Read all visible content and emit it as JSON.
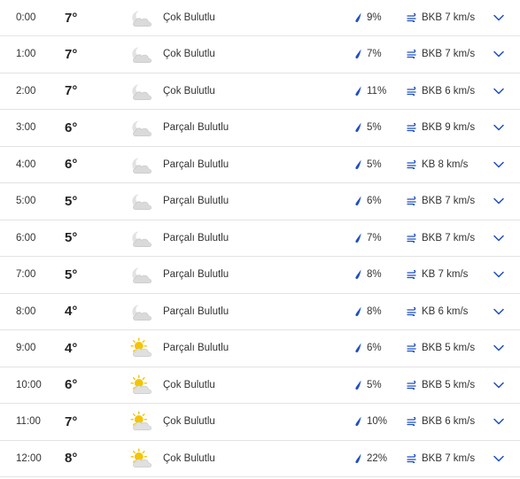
{
  "colors": {
    "accent_blue": "#1e4fc2",
    "divider": "#e3e3e3",
    "cloud": "#d6d6d6",
    "sun": "#f5c400"
  },
  "rows": [
    {
      "time": "0:00",
      "temp": "7°",
      "icon": "night-cloudy-icon",
      "condition": "Çok Bulutlu",
      "precip": "9%",
      "wind": "BKB 7 km/s"
    },
    {
      "time": "1:00",
      "temp": "7°",
      "icon": "night-cloudy-icon",
      "condition": "Çok Bulutlu",
      "precip": "7%",
      "wind": "BKB 7 km/s"
    },
    {
      "time": "2:00",
      "temp": "7°",
      "icon": "night-cloudy-icon",
      "condition": "Çok Bulutlu",
      "precip": "11%",
      "wind": "BKB 6 km/s"
    },
    {
      "time": "3:00",
      "temp": "6°",
      "icon": "night-partly-cloudy-icon",
      "condition": "Parçalı Bulutlu",
      "precip": "5%",
      "wind": "BKB 9 km/s"
    },
    {
      "time": "4:00",
      "temp": "6°",
      "icon": "night-partly-cloudy-icon",
      "condition": "Parçalı Bulutlu",
      "precip": "5%",
      "wind": "KB 8 km/s"
    },
    {
      "time": "5:00",
      "temp": "5°",
      "icon": "night-partly-cloudy-icon",
      "condition": "Parçalı Bulutlu",
      "precip": "6%",
      "wind": "BKB 7 km/s"
    },
    {
      "time": "6:00",
      "temp": "5°",
      "icon": "night-partly-cloudy-icon",
      "condition": "Parçalı Bulutlu",
      "precip": "7%",
      "wind": "BKB 7 km/s"
    },
    {
      "time": "7:00",
      "temp": "5°",
      "icon": "night-partly-cloudy-icon",
      "condition": "Parçalı Bulutlu",
      "precip": "8%",
      "wind": "KB 7 km/s"
    },
    {
      "time": "8:00",
      "temp": "4°",
      "icon": "night-partly-cloudy-icon",
      "condition": "Parçalı Bulutlu",
      "precip": "8%",
      "wind": "KB 6 km/s"
    },
    {
      "time": "9:00",
      "temp": "4°",
      "icon": "day-partly-cloudy-icon",
      "condition": "Parçalı Bulutlu",
      "precip": "6%",
      "wind": "BKB 5 km/s"
    },
    {
      "time": "10:00",
      "temp": "6°",
      "icon": "day-cloudy-icon",
      "condition": "Çok Bulutlu",
      "precip": "5%",
      "wind": "BKB 5 km/s"
    },
    {
      "time": "11:00",
      "temp": "7°",
      "icon": "day-cloudy-icon",
      "condition": "Çok Bulutlu",
      "precip": "10%",
      "wind": "BKB 6 km/s"
    },
    {
      "time": "12:00",
      "temp": "8°",
      "icon": "day-cloudy-icon",
      "condition": "Çok Bulutlu",
      "precip": "22%",
      "wind": "BKB 7 km/s"
    }
  ]
}
